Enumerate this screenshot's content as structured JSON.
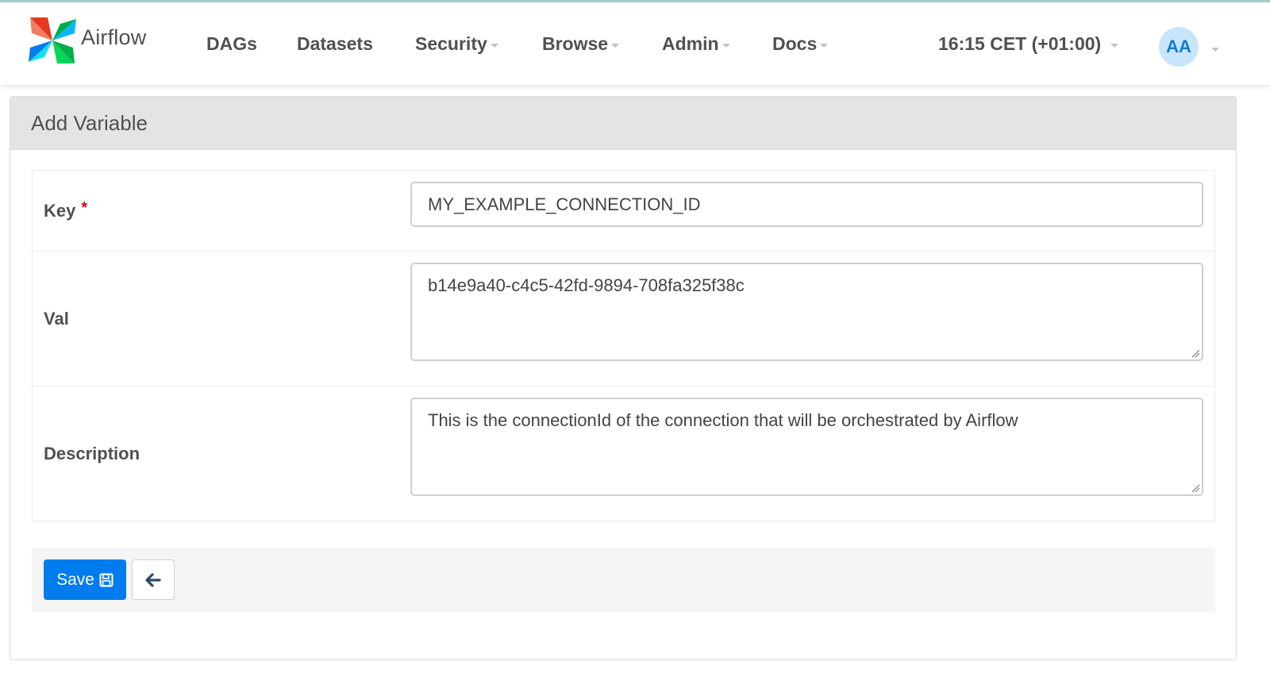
{
  "brand": {
    "name": "Airflow",
    "logo_icon": "airflow-pinwheel-logo"
  },
  "nav": {
    "items": [
      {
        "label": "DAGs",
        "dropdown": false
      },
      {
        "label": "Datasets",
        "dropdown": false
      },
      {
        "label": "Security",
        "dropdown": true
      },
      {
        "label": "Browse",
        "dropdown": true
      },
      {
        "label": "Admin",
        "dropdown": true
      },
      {
        "label": "Docs",
        "dropdown": true
      }
    ],
    "timezone": "16:15 CET (+01:00)",
    "user_initials": "AA"
  },
  "form": {
    "title": "Add Variable",
    "fields": {
      "key": {
        "label": "Key",
        "required_marker": "*",
        "value": "MY_EXAMPLE_CONNECTION_ID"
      },
      "val": {
        "label": "Val",
        "value": "b14e9a40-c4c5-42fd-9894-708fa325f38c"
      },
      "description": {
        "label": "Description",
        "value": "This is the connectionId of the connection that will be orchestrated by Airflow"
      }
    },
    "actions": {
      "save_label": "Save",
      "save_icon": "floppy-disk-icon",
      "back_icon": "arrow-left-icon"
    }
  },
  "colors": {
    "primary": "#017cee",
    "nav_text": "#51504f",
    "required": "#d9001b",
    "avatar_bg": "#c9e5fb",
    "avatar_text": "#0f7ad8"
  }
}
